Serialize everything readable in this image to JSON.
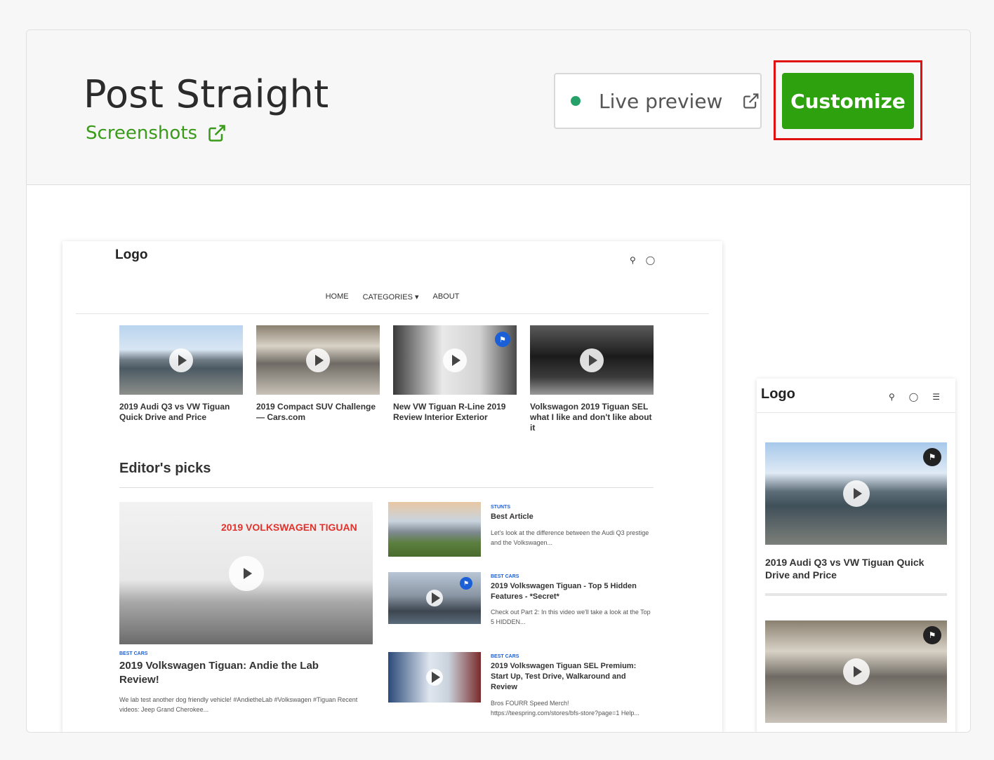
{
  "header": {
    "title": "Post Straight",
    "screenshots_link": "Screenshots",
    "live_preview": "Live preview",
    "customize": "Customize"
  },
  "colors": {
    "accent": "#2ea10f",
    "link": "#3a9b1a",
    "highlight": "#e01010",
    "live_dot": "#26a169"
  },
  "desktop_preview": {
    "logo": "Logo",
    "nav": [
      "HOME",
      "CATEGORIES",
      "ABOUT"
    ],
    "top_cards": [
      {
        "title": "2019 Audi Q3 vs VW Tiguan Quick Drive and Price"
      },
      {
        "title": "2019 Compact SUV Challenge — Cars.com"
      },
      {
        "title": "New VW Tiguan R-Line 2019 Review Interior Exterior"
      },
      {
        "title": "Volkswagon 2019 Tiguan SEL what I like and don't like about it"
      }
    ],
    "editors_picks": "Editor's picks",
    "big_post": {
      "banner": "2019 VOLKSWAGEN TIGUAN",
      "category": "BEST CARS",
      "title": "2019 Volkswagen Tiguan: Andie the Lab Review!",
      "excerpt": "We lab test another dog friendly vehicle! #AndietheLab #Volkswagen #Tiguan Recent videos: Jeep Grand Cherokee..."
    },
    "side_posts": [
      {
        "category": "STUNTS",
        "title": "Best Article",
        "excerpt": "Let's look at the difference between the Audi Q3 prestige and the Volkswagen..."
      },
      {
        "category": "BEST CARS",
        "title": "2019 Volkswagen Tiguan - Top 5 Hidden Features - *Secret*",
        "excerpt": "Check out Part 2: In this video we'll take a look at the Top 5 HIDDEN..."
      },
      {
        "category": "BEST CARS",
        "title": "2019 Volkswagen Tiguan SEL Premium: Start Up, Test Drive, Walkaround and Review",
        "excerpt": "Bros FOURR Speed Merch! https://teespring.com/stores/bfs-store?page=1 Help..."
      }
    ]
  },
  "mobile_preview": {
    "logo": "Logo",
    "post_title": "2019 Audi Q3 vs VW Tiguan Quick Drive and Price"
  }
}
